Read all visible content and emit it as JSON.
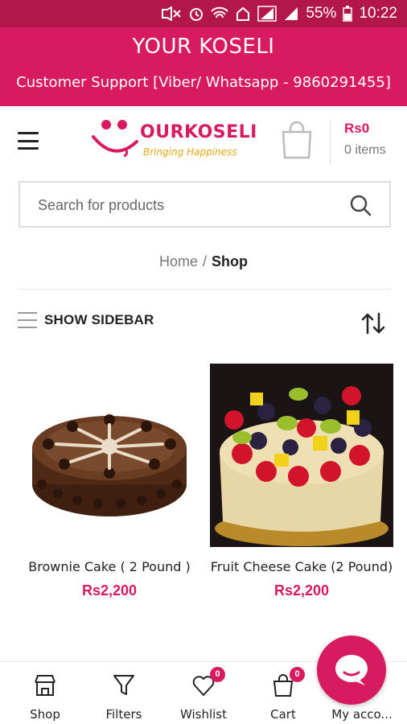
{
  "status_bar": {
    "battery": "55%",
    "time": "10:22",
    "icons": [
      "mute-icon",
      "alarm-icon",
      "wifi-icon",
      "home-icon",
      "signal-icon",
      "signal-icon",
      "battery-icon"
    ]
  },
  "banner": {
    "title": "YOUR KOSELI",
    "support": "Customer Support [Viber/ Whatsapp - 9860291455]"
  },
  "header": {
    "logo_text": "OURKOSELI",
    "logo_tagline": "Bringing Happiness",
    "cart_total": "Rs0",
    "cart_items": "0 items"
  },
  "search": {
    "placeholder": "Search for products"
  },
  "breadcrumb": {
    "home": "Home",
    "separator": "/",
    "current": "Shop"
  },
  "toolbar": {
    "sidebar_label": "SHOW SIDEBAR"
  },
  "products": [
    {
      "name": "Brownie Cake ( 2 Pound )",
      "price": "Rs2,200"
    },
    {
      "name": "Fruit Cheese Cake (2 Pound)",
      "price": "Rs2,200"
    }
  ],
  "bottom_nav": {
    "items": [
      {
        "label": "Shop",
        "icon": "store-icon"
      },
      {
        "label": "Filters",
        "icon": "filter-icon"
      },
      {
        "label": "Wishlist",
        "icon": "heart-icon",
        "badge": "0"
      },
      {
        "label": "Cart",
        "icon": "bag-icon",
        "badge": "0"
      },
      {
        "label": "My acco...",
        "icon": "account-icon"
      }
    ]
  },
  "colors": {
    "brand": "#d81b60",
    "status_bar": "#b3164a",
    "logo_tagline": "#e6a817"
  }
}
